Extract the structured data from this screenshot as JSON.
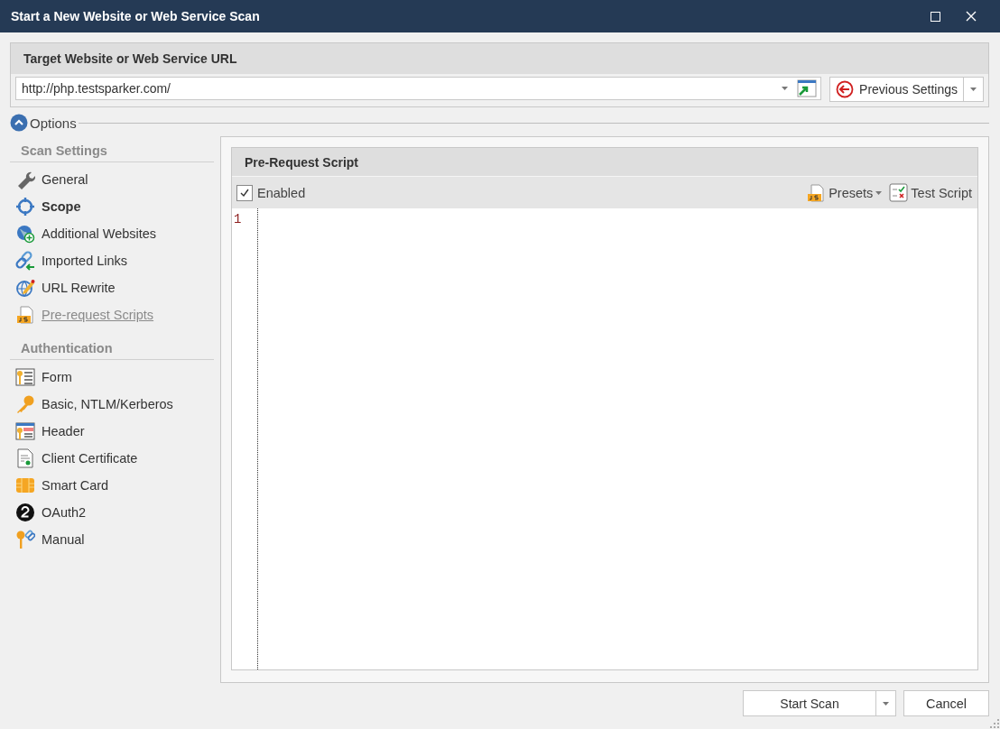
{
  "window": {
    "title": "Start a New Website or Web Service Scan"
  },
  "target": {
    "heading": "Target Website or Web Service URL",
    "url": "http://php.testsparker.com/",
    "previous_button": "Previous Settings"
  },
  "options": {
    "label": "Options",
    "expanded": true
  },
  "sidebar": {
    "sections": [
      {
        "heading": "Scan Settings",
        "items": [
          {
            "label": "General",
            "kind": "wrench",
            "selected": false,
            "emphasized": false
          },
          {
            "label": "Scope",
            "kind": "target",
            "selected": false,
            "emphasized": true
          },
          {
            "label": "Additional Websites",
            "kind": "globe-plus",
            "selected": false,
            "emphasized": false
          },
          {
            "label": "Imported Links",
            "kind": "link",
            "selected": false,
            "emphasized": false
          },
          {
            "label": "URL Rewrite",
            "kind": "globe-pencil",
            "selected": false,
            "emphasized": false
          },
          {
            "label": "Pre-request Scripts",
            "kind": "js-file",
            "selected": true,
            "emphasized": false
          }
        ]
      },
      {
        "heading": "Authentication",
        "items": [
          {
            "label": "Form",
            "kind": "form-key",
            "selected": false,
            "emphasized": false
          },
          {
            "label": "Basic, NTLM/Kerberos",
            "kind": "key",
            "selected": false,
            "emphasized": false
          },
          {
            "label": "Header",
            "kind": "header-key",
            "selected": false,
            "emphasized": false
          },
          {
            "label": "Client Certificate",
            "kind": "certificate",
            "selected": false,
            "emphasized": false
          },
          {
            "label": "Smart Card",
            "kind": "chip",
            "selected": false,
            "emphasized": false
          },
          {
            "label": "OAuth2",
            "kind": "oauth",
            "selected": false,
            "emphasized": false
          },
          {
            "label": "Manual",
            "kind": "key-link",
            "selected": false,
            "emphasized": false
          }
        ]
      }
    ]
  },
  "script_panel": {
    "heading": "Pre-Request Script",
    "enabled": {
      "label": "Enabled",
      "checked": true
    },
    "presets": "Presets",
    "test_script": "Test Script",
    "line_numbers": [
      "1"
    ]
  },
  "buttons": {
    "start": "Start Scan",
    "cancel": "Cancel"
  }
}
